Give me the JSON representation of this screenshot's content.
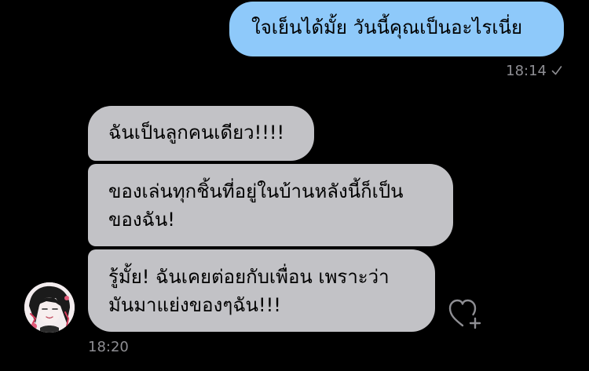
{
  "chat": {
    "outgoing": [
      {
        "text": "ใจเย็นได้มั้ย วันนี้คุณเป็นอะไรเนี่ย",
        "time": "18:14",
        "status_icon": "check-icon"
      }
    ],
    "incoming": {
      "avatar_icon": "contact-avatar",
      "time": "18:20",
      "messages": [
        {
          "text": "ฉันเป็นลูกคนเดียว!!!!"
        },
        {
          "text": "ของเล่นทุกชิ้นที่อยู่ในบ้านหลังนี้ก็เป็น\nของฉัน!"
        },
        {
          "text": "รู้มั้ย! ฉันเคยต่อยกับเพื่อน เพราะว่า\nมันมาแย่งของๆฉัน!!!"
        }
      ],
      "reaction_icon": "heart-plus-icon"
    }
  },
  "colors": {
    "background": "#000000",
    "outgoing_bubble": "#8ec9fa",
    "incoming_bubble": "#c2c2c6",
    "timestamp": "#8e8e93"
  }
}
